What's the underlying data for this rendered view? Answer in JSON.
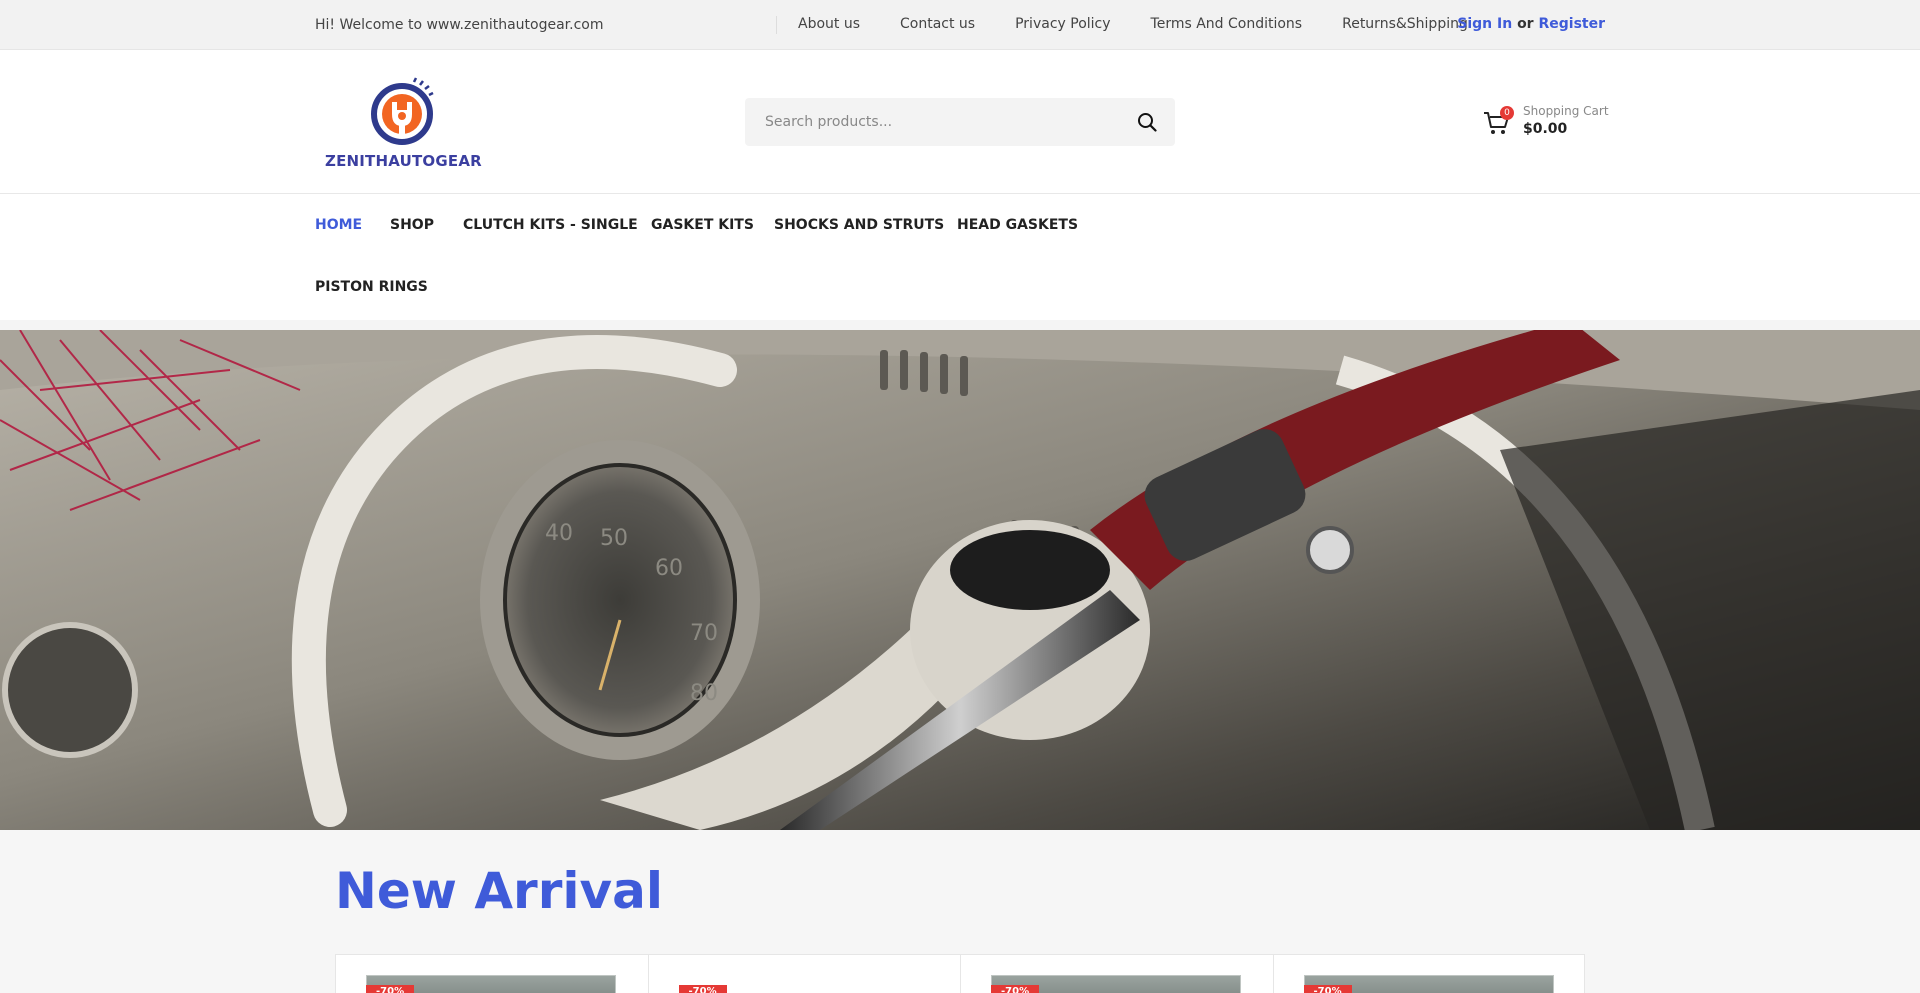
{
  "topbar": {
    "welcome": "Hi! Welcome to www.zenithautogear.com",
    "links": [
      "About us",
      "Contact us",
      "Privacy Policy",
      "Terms And Conditions",
      "Returns&Shipping"
    ],
    "sign_in": "Sign In",
    "or": "or",
    "register": "Register"
  },
  "header": {
    "brand": "ZENITHAUTOGEAR",
    "search_placeholder": "Search products...",
    "cart_label": "Shopping Cart",
    "cart_total": "$0.00",
    "cart_count": "0"
  },
  "nav": {
    "items": [
      "HOME",
      "SHOP",
      "CLUTCH KITS - SINGLE",
      "GASKET KITS",
      "SHOCKS AND STRUTS",
      "HEAD GASKETS",
      "PISTON RINGS"
    ]
  },
  "section": {
    "title": "New Arrival"
  },
  "products": [
    {
      "badge": "-70%"
    },
    {
      "badge": "-70%"
    },
    {
      "badge": "-70%"
    },
    {
      "badge": "-70%"
    }
  ],
  "colors": {
    "accent": "#3f5bd9",
    "sale": "#e53935",
    "logo_orange": "#f26522",
    "logo_navy": "#2e3a8c"
  },
  "icons": {
    "search": "search-icon",
    "cart": "cart-icon"
  }
}
